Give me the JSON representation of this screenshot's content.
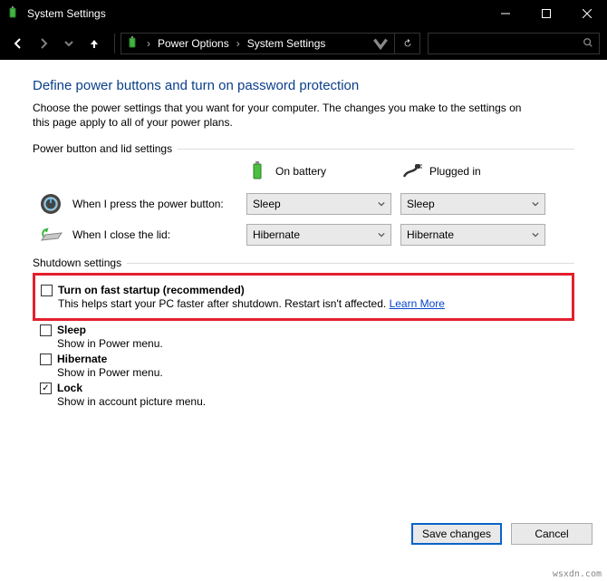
{
  "window": {
    "title": "System Settings"
  },
  "breadcrumb": {
    "level1": "Power Options",
    "level2": "System Settings"
  },
  "page": {
    "heading": "Define power buttons and turn on password protection",
    "intro": "Choose the power settings that you want for your computer. The changes you make to the settings on this page apply to all of your power plans."
  },
  "sections": {
    "powerButtons": "Power button and lid settings",
    "shutdown": "Shutdown settings"
  },
  "columns": {
    "battery": "On battery",
    "plugged": "Plugged in"
  },
  "rows": {
    "powerButton": {
      "label": "When I press the power button:",
      "battery": "Sleep",
      "plugged": "Sleep"
    },
    "lid": {
      "label": "When I close the lid:",
      "battery": "Hibernate",
      "plugged": "Hibernate"
    }
  },
  "shutdownItems": {
    "fast": {
      "title": "Turn on fast startup (recommended)",
      "desc_pre": "This helps start your PC faster after shutdown. Restart isn't affected. ",
      "link": "Learn More"
    },
    "sleep": {
      "title": "Sleep",
      "desc": "Show in Power menu."
    },
    "hibernate": {
      "title": "Hibernate",
      "desc": "Show in Power menu."
    },
    "lock": {
      "title": "Lock",
      "desc": "Show in account picture menu."
    }
  },
  "buttons": {
    "save": "Save changes",
    "cancel": "Cancel"
  },
  "watermark": "wsxdn.com"
}
